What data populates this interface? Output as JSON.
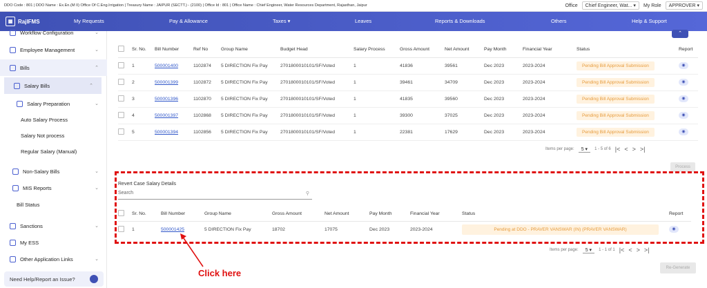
{
  "infobar": {
    "text": "DDO Code : 801 | DDO Name : Ex.En.(M II) Office Of C.Eng.Irrigation | Treasury Name : JAIPUR (SECTT.) - (2100) | Office Id : 801 | Office Name : Chief Engineer, Water Resources Department, Rajasthan, Jaipur",
    "office_label": "Office",
    "office_value": "Chief Engineer, Wat...",
    "role_label": "My Role",
    "role_value": "APPROVER"
  },
  "nav": {
    "brand": "RajIFMS",
    "items": [
      "My Requests",
      "Pay & Allowance",
      "Taxes",
      "Leaves",
      "Reports & Downloads",
      "Others",
      "Help & Support"
    ]
  },
  "sidebar": {
    "items": [
      {
        "label": "Workflow Configuration"
      },
      {
        "label": "Employee Management"
      },
      {
        "label": "Bills"
      },
      {
        "label": "Salary Bills"
      },
      {
        "label": "Salary Preparation"
      },
      {
        "label": "Auto Salary Process"
      },
      {
        "label": "Salary Not process"
      },
      {
        "label": "Regular Salary (Manual)"
      },
      {
        "label": "Non-Salary Bills"
      },
      {
        "label": "MIS Reports"
      },
      {
        "label": "Bill Status"
      },
      {
        "label": "Sanctions"
      },
      {
        "label": "My ESS"
      },
      {
        "label": "Other Application Links"
      }
    ],
    "help": "Need Help/Report an Issue?"
  },
  "table1": {
    "headers": [
      "Sr. No.",
      "Bill Number",
      "Ref No",
      "Group Name",
      "Budget Head",
      "Salary Process",
      "Gross Amount",
      "Net Amount",
      "Pay Month",
      "Financial Year",
      "Status",
      "Report"
    ],
    "rows": [
      {
        "sr": "1",
        "bill": "500001400",
        "ref": "1102874",
        "group": "5 DIRECTION Fix Pay",
        "head": "2701800010101/SF/Voted",
        "proc": "1",
        "gross": "41836",
        "net": "39561",
        "month": "Dec 2023",
        "fy": "2023-2024",
        "status": "Pending Bill Approval Submission"
      },
      {
        "sr": "2",
        "bill": "500001399",
        "ref": "1102872",
        "group": "5 DIRECTION Fix Pay",
        "head": "2701800010101/SF/Voted",
        "proc": "1",
        "gross": "39461",
        "net": "34709",
        "month": "Dec 2023",
        "fy": "2023-2024",
        "status": "Pending Bill Approval Submission"
      },
      {
        "sr": "3",
        "bill": "500001396",
        "ref": "1102870",
        "group": "5 DIRECTION Fix Pay",
        "head": "2701800010101/SF/Voted",
        "proc": "1",
        "gross": "41835",
        "net": "39560",
        "month": "Dec 2023",
        "fy": "2023-2024",
        "status": "Pending Bill Approval Submission"
      },
      {
        "sr": "4",
        "bill": "500001397",
        "ref": "1102868",
        "group": "5 DIRECTION Fix Pay",
        "head": "2701800010101/SF/Voted",
        "proc": "1",
        "gross": "39300",
        "net": "37025",
        "month": "Dec 2023",
        "fy": "2023-2024",
        "status": "Pending Bill Approval Submission"
      },
      {
        "sr": "5",
        "bill": "500001394",
        "ref": "1102856",
        "group": "5 DIRECTION Fix Pay",
        "head": "2701800010101/SF/Voted",
        "proc": "1",
        "gross": "22381",
        "net": "17629",
        "month": "Dec 2023",
        "fy": "2023-2024",
        "status": "Pending Bill Approval Submission"
      }
    ],
    "pager": {
      "label": "Items per page:",
      "size": "5",
      "range": "1 - 5 of 6"
    },
    "button": "Process"
  },
  "table2": {
    "title": "Revert Case Salary Details",
    "search_placeholder": "Search",
    "headers": [
      "Sr. No.",
      "Bill Number",
      "Group Name",
      "Gross Amount",
      "Net Amount",
      "Pay Month",
      "Financial Year",
      "Status",
      "Report"
    ],
    "row": {
      "sr": "1",
      "bill": "500001425",
      "group": "5 DIRECTION Fix Pay",
      "gross": "18702",
      "net": "17075",
      "month": "Dec 2023",
      "fy": "2023-2024",
      "status": "Pending at DDO - PRAVER VANSWAR (IN) (PRAVER VANSWAR)"
    },
    "pager": {
      "label": "Items per page:",
      "size": "5",
      "range": "1 - 1 of 1"
    },
    "button": "Re-Generate"
  },
  "annotation": "Click here",
  "colors": {
    "accent": "#3f51b5",
    "annotation": "#e01010",
    "status_bg": "#fff2df",
    "status_text": "#e69a3a"
  }
}
